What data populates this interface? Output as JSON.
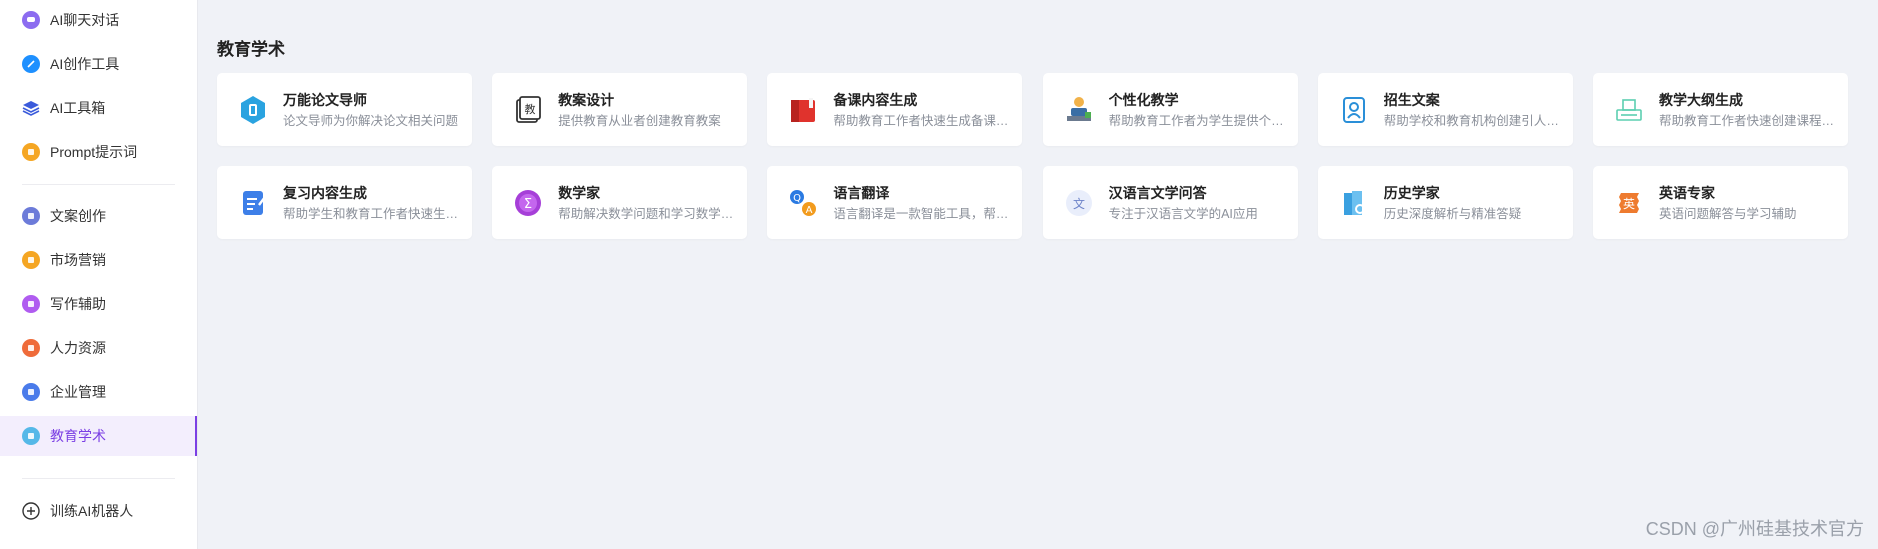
{
  "sidebar": {
    "top_items": [
      {
        "label": "AI聊天对话",
        "icon": "chat-icon",
        "color": "#8c6cf0",
        "active": false
      },
      {
        "label": "AI创作工具",
        "icon": "pen-icon",
        "color": "#1e90ff",
        "active": false
      },
      {
        "label": "AI工具箱",
        "icon": "layers-icon",
        "color": "#3b5bdb",
        "active": false
      },
      {
        "label": "Prompt提示词",
        "icon": "prompt-icon",
        "color": "#f5a623",
        "active": false
      }
    ],
    "category_items": [
      {
        "label": "文案创作",
        "icon": "copywriting-icon",
        "color": "#6c7bd9",
        "active": false
      },
      {
        "label": "市场营销",
        "icon": "marketing-icon",
        "color": "#f5a623",
        "active": false
      },
      {
        "label": "写作辅助",
        "icon": "writing-icon",
        "color": "#b05cf0",
        "active": false
      },
      {
        "label": "人力资源",
        "icon": "hr-icon",
        "color": "#ef6b3a",
        "active": false
      },
      {
        "label": "企业管理",
        "icon": "management-icon",
        "color": "#4a7bea",
        "active": false
      },
      {
        "label": "教育学术",
        "icon": "education-icon",
        "color": "#55b8e8",
        "active": true
      }
    ],
    "train_label": "训练AI机器人"
  },
  "main": {
    "title": "教育学术",
    "cards": [
      {
        "title": "万能论文导师",
        "desc": "论文导师为你解决论文相关问题",
        "icon": "thesis-icon"
      },
      {
        "title": "教案设计",
        "desc": "提供教育从业者创建教育教案",
        "icon": "lesson-plan-icon"
      },
      {
        "title": "备课内容生成",
        "desc": "帮助教育工作者快速生成备课内容",
        "icon": "lesson-prep-icon"
      },
      {
        "title": "个性化教学",
        "desc": "帮助教育工作者为学生提供个性化教学",
        "icon": "personalized-teaching-icon"
      },
      {
        "title": "招生文案",
        "desc": "帮助学校和教育机构创建引人注目的招生文案",
        "icon": "enrollment-icon"
      },
      {
        "title": "教学大纲生成",
        "desc": "帮助教育工作者快速创建课程大纲",
        "icon": "syllabus-icon"
      },
      {
        "title": "复习内容生成",
        "desc": "帮助学生和教育工作者快速生成复习内容",
        "icon": "review-icon"
      },
      {
        "title": "数学家",
        "desc": "帮助解决数学问题和学习数学知识",
        "icon": "math-icon"
      },
      {
        "title": "语言翻译",
        "desc": "语言翻译是一款智能工具，帮助翻译",
        "icon": "translate-icon"
      },
      {
        "title": "汉语言文学问答",
        "desc": "专注于汉语言文学的AI应用",
        "icon": "chinese-literature-icon"
      },
      {
        "title": "历史学家",
        "desc": "历史深度解析与精准答疑",
        "icon": "history-icon"
      },
      {
        "title": "英语专家",
        "desc": "英语问题解答与学习辅助",
        "icon": "english-icon"
      }
    ]
  },
  "watermark": "CSDN @广州硅基技术官方"
}
